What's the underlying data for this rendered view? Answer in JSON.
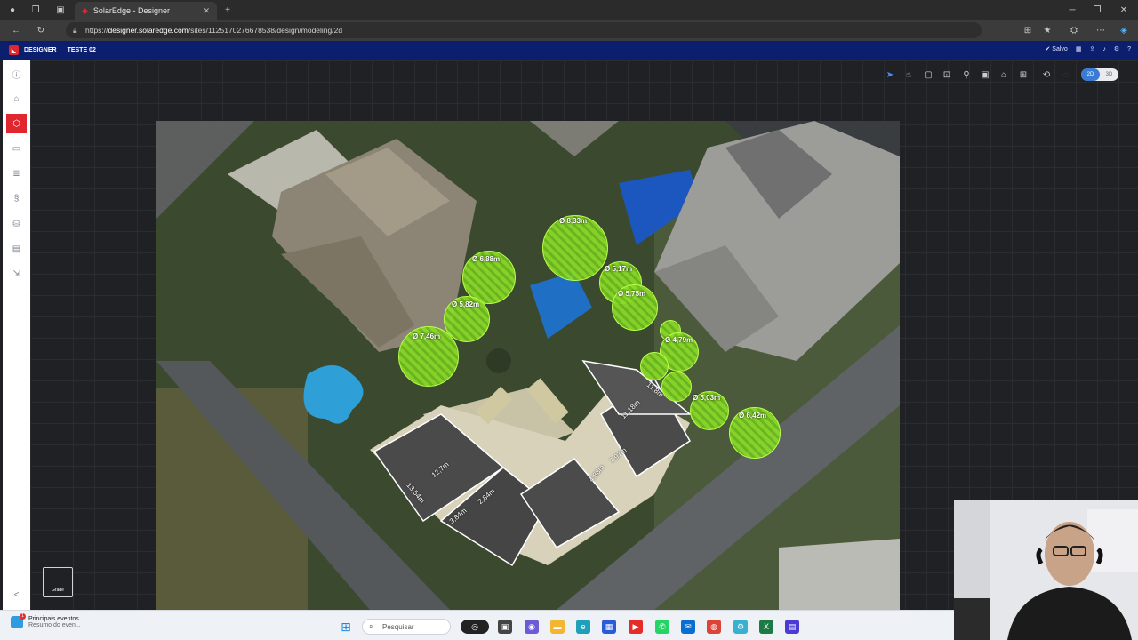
{
  "browser": {
    "tab_title": "SolarEdge - Designer",
    "url_host": "designer.solaredge.com",
    "url_path": "/sites/1125170276678538/design/modeling/2d",
    "url_prefix": "https://"
  },
  "app": {
    "brand": "DESIGNER",
    "project": "TESTE 02",
    "status": "Salvo"
  },
  "toolbar": {
    "view_toggle": [
      "2D",
      "3D"
    ],
    "active_view": "2D"
  },
  "sidebar": {
    "items": [
      "info",
      "home",
      "module",
      "panel",
      "layers",
      "strings",
      "storage",
      "report",
      "export"
    ],
    "active": "module"
  },
  "map": {
    "trees": [
      {
        "label": "Ø 8,33m"
      },
      {
        "label": "Ø 6,88m"
      },
      {
        "label": "Ø 5,17m"
      },
      {
        "label": "Ø 5,75m"
      },
      {
        "label": "Ø 5,82m"
      },
      {
        "label": "Ø 7,46m"
      },
      {
        "label": "Ø 4,79m"
      },
      {
        "label": "Ø 5,03m"
      },
      {
        "label": "Ø 6,42m"
      }
    ],
    "roof_labels": [
      "12,7m",
      "13,54m",
      "3,84m",
      "2,84m",
      "7,97m",
      "4,88m",
      "11,18m",
      "11,8m"
    ]
  },
  "grade_button": {
    "label": "Grade"
  },
  "taskbar": {
    "notification_title": "Principais eventos",
    "notification_sub": "Resumo do even...",
    "notification_count": "1",
    "search_placeholder": "Pesquisar"
  }
}
